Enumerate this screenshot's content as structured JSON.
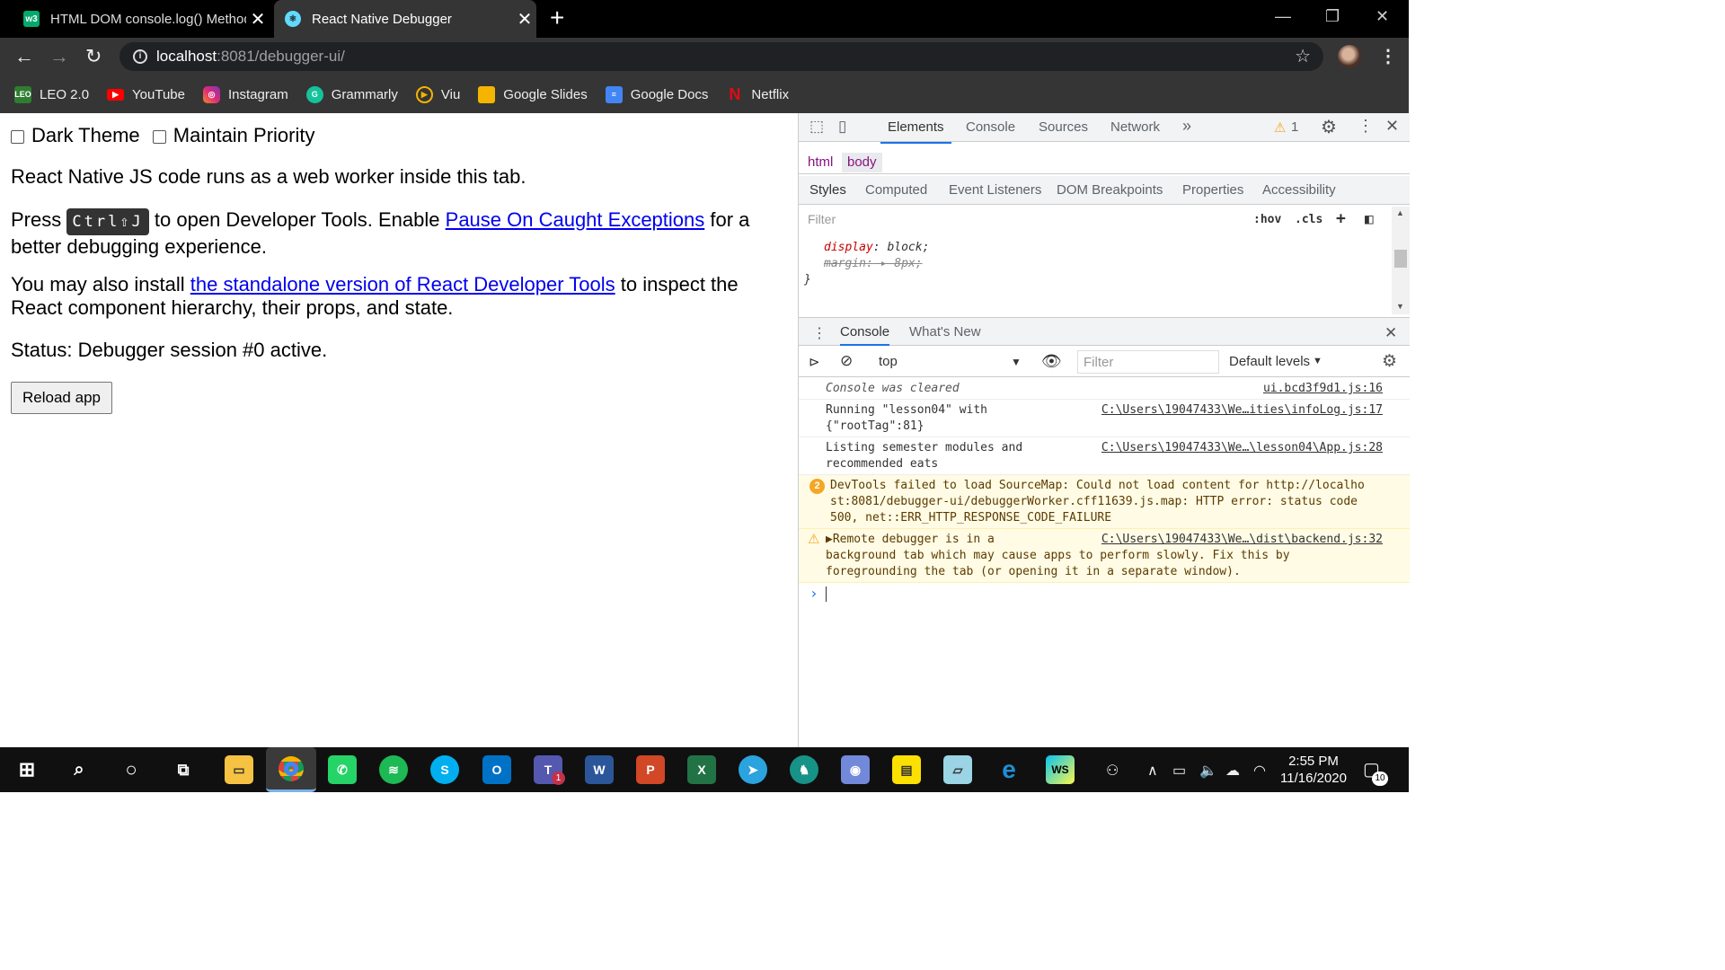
{
  "browser": {
    "tabs": [
      {
        "title": "HTML DOM console.log() Method",
        "icon": "w3schools-icon",
        "active": false
      },
      {
        "title": "React Native Debugger",
        "icon": "react-icon",
        "active": true
      }
    ],
    "url_host": "localhost",
    "url_rest": ":8081/debugger-ui/",
    "bookmarks": [
      {
        "label": "LEO 2.0",
        "icon": "leo-icon",
        "color": "#2e7d32"
      },
      {
        "label": "YouTube",
        "icon": "youtube-icon",
        "color": "#ff0000"
      },
      {
        "label": "Instagram",
        "icon": "instagram-icon",
        "color": "#c13584"
      },
      {
        "label": "Grammarly",
        "icon": "grammarly-icon",
        "color": "#15c39a"
      },
      {
        "label": "Viu",
        "icon": "viu-icon",
        "color": "#f5b400"
      },
      {
        "label": "Google Slides",
        "icon": "slides-icon",
        "color": "#f4b400"
      },
      {
        "label": "Google Docs",
        "icon": "docs-icon",
        "color": "#4285f4"
      },
      {
        "label": "Netflix",
        "icon": "netflix-icon",
        "color": "#e50914"
      }
    ]
  },
  "page": {
    "dark_theme": "Dark Theme",
    "maintain_priority": "Maintain Priority",
    "intro": "React Native JS code runs as a web worker inside this tab.",
    "press": "Press",
    "shortcut": "Ctrl⇧J",
    "press_mid": "to open Developer Tools. Enable",
    "pause_link": "Pause On Caught Exceptions",
    "press_end": "for a better debugging experience.",
    "install_pre": "You may also install",
    "install_link": "the standalone version of React Developer Tools",
    "install_post": "to inspect the React component hierarchy, their props, and state.",
    "status": "Status: Debugger session #0 active.",
    "reload": "Reload app"
  },
  "devtools": {
    "tabs": [
      "Elements",
      "Console",
      "Sources",
      "Network"
    ],
    "more": "»",
    "warning_count": "1",
    "breadcrumb": [
      "html",
      "body"
    ],
    "style_tabs": [
      "Styles",
      "Computed",
      "Event Listeners",
      "DOM Breakpoints",
      "Properties",
      "Accessibility"
    ],
    "filter_placeholder": "Filter",
    "hov": ":hov",
    "cls": ".cls",
    "css_display_prop": "display",
    "css_display_val": "block;",
    "css_margin_prop": "margin:",
    "css_margin_val": "8px;",
    "drawer_tabs": [
      "Console",
      "What's New"
    ],
    "context": "top",
    "console_filter": "Filter",
    "levels": "Default levels",
    "messages": [
      {
        "text": "Console was cleared",
        "source": "ui.bcd3f9d1.js:16",
        "type": "info"
      },
      {
        "text": "Running \"lesson04\" with\n{\"rootTag\":81}",
        "source": "C:\\Users\\19047433\\We…ities\\infoLog.js:17",
        "type": "log"
      },
      {
        "text": "Listing semester modules and\nrecommended eats",
        "source": "C:\\Users\\19047433\\We…\\lesson04\\App.js:28",
        "type": "log"
      },
      {
        "text": "DevTools failed to load SourceMap: Could not load content for http://localho\nst:8081/debugger-ui/debuggerWorker.cff11639.js.map: HTTP error: status code\n500, net::ERR_HTTP_RESPONSE_CODE_FAILURE",
        "source": "",
        "type": "warn",
        "count": "2"
      },
      {
        "text": "▶Remote debugger is in a\nbackground tab which may cause apps to perform slowly. Fix this by\nforegrounding the tab (or opening it in a separate window).",
        "source": "C:\\Users\\19047433\\We…\\dist\\backend.js:32",
        "type": "warn"
      }
    ]
  },
  "taskbar": {
    "time": "2:55 PM",
    "date": "11/16/2020",
    "notifications": "10",
    "teams_badge": "1"
  }
}
